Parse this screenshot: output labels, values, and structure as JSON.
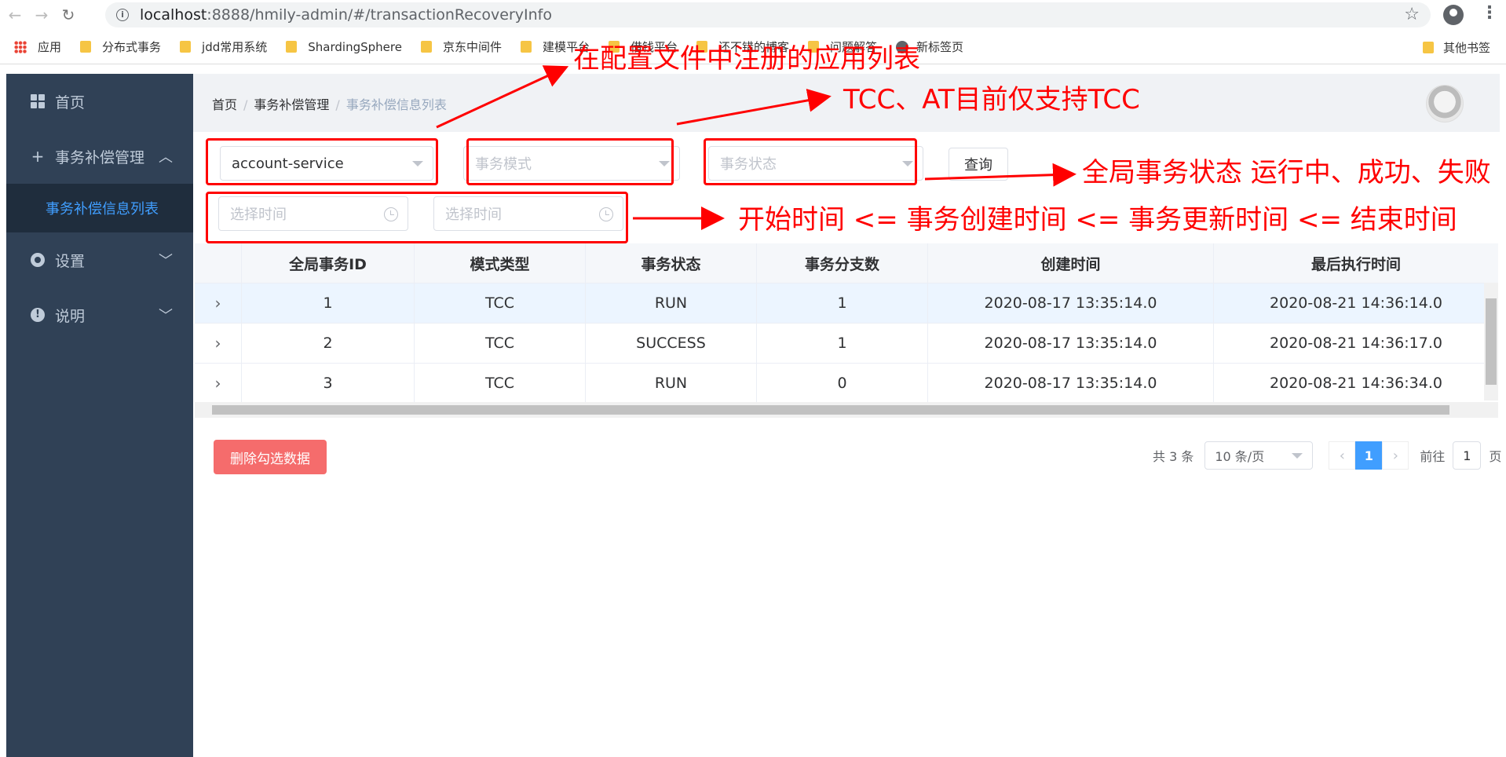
{
  "browser": {
    "url_host": "localhost",
    "url_path": ":8888/hmily-admin/#/transactionRecoveryInfo",
    "bookmarks": [
      "应用",
      "分布式事务",
      "jdd常用系统",
      "ShardingSphere",
      "京东中间件",
      "建模平台",
      "借钱平台",
      "还不错的博客",
      "问题解答",
      "新标签页"
    ],
    "other_bookmarks": "其他书签"
  },
  "sidebar": {
    "items": [
      {
        "label": "首页",
        "icon": "dashboard-icon"
      },
      {
        "label": "事务补偿管理",
        "icon": "plus-icon",
        "sub": "事务补偿信息列表"
      },
      {
        "label": "设置",
        "icon": "gear-icon"
      },
      {
        "label": "说明",
        "icon": "info-icon"
      }
    ]
  },
  "breadcrumb": [
    "首页",
    "事务补偿管理",
    "事务补偿信息列表"
  ],
  "filters": {
    "app_value": "account-service",
    "mode_placeholder": "事务模式",
    "status_placeholder": "事务状态",
    "start_placeholder": "选择时间",
    "end_placeholder": "选择时间",
    "query_label": "查询"
  },
  "annotations": {
    "app": "在配置文件中注册的应用列表",
    "mode": "TCC、AT目前仅支持TCC",
    "status": "全局事务状态 运行中、成功、失败",
    "time": "开始时间 <= 事务创建时间 <= 事务更新时间 <= 结束时间",
    "color": "#ff0000"
  },
  "table": {
    "headers": [
      "全局事务ID",
      "模式类型",
      "事务状态",
      "事务分支数",
      "创建时间",
      "最后执行时间"
    ],
    "rows": [
      [
        "1",
        "TCC",
        "RUN",
        "1",
        "2020-08-17 13:35:14.0",
        "2020-08-21 14:36:14.0"
      ],
      [
        "2",
        "TCC",
        "SUCCESS",
        "1",
        "2020-08-17 13:35:14.0",
        "2020-08-21 14:36:17.0"
      ],
      [
        "3",
        "TCC",
        "RUN",
        "0",
        "2020-08-17 13:35:14.0",
        "2020-08-21 14:36:34.0"
      ]
    ]
  },
  "footer": {
    "delete_label": "删除勾选数据",
    "total_text": "共 3 条",
    "page_size": "10 条/页",
    "current_page": "1",
    "goto_prefix": "前往",
    "goto_value": "1",
    "goto_suffix": "页"
  },
  "colors": {
    "sidebar_bg": "#304156",
    "accent": "#409eff",
    "danger": "#f56c6c"
  }
}
